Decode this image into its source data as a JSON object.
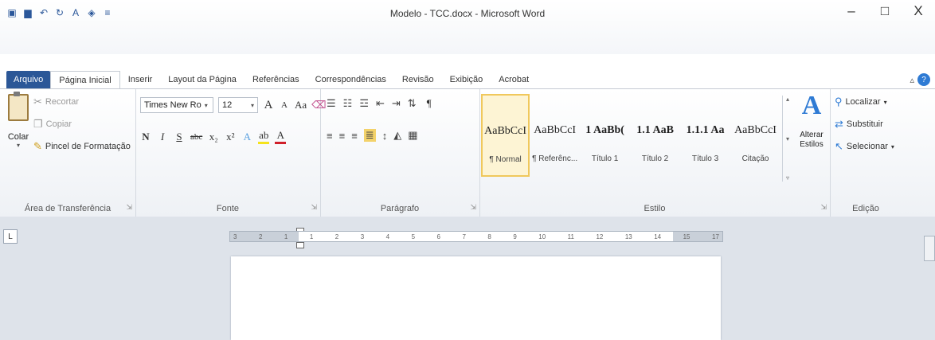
{
  "window": {
    "title": "Modelo - TCC.docx - Microsoft Word",
    "minimize": "–",
    "maximize": "□",
    "close": "X"
  },
  "qat": [
    {
      "icon": "word-icon"
    },
    {
      "icon": "save-icon"
    },
    {
      "icon": "undo-icon"
    },
    {
      "icon": "redo-icon"
    },
    {
      "icon": "font-color-icon"
    },
    {
      "icon": "highlight-icon"
    },
    {
      "icon": "customize-icon"
    }
  ],
  "tabs": {
    "file": "Arquivo",
    "home": "Página Inicial",
    "insert": "Inserir",
    "layout": "Layout da Página",
    "references": "Referências",
    "mailings": "Correspondências",
    "review": "Revisão",
    "view": "Exibição",
    "acrobat": "Acrobat"
  },
  "ribbon": {
    "clipboard": {
      "label": "Área de Transferência",
      "paste": "Colar",
      "cut": "Recortar",
      "copy": "Copiar",
      "format_painter": "Pincel de Formatação"
    },
    "font": {
      "label": "Fonte",
      "font_name": "Times New Ro",
      "font_size": "12",
      "bold": "N",
      "italic": "I",
      "underline": "S",
      "strike": "abc",
      "subscript": "x₂",
      "superscript": "x²",
      "grow": "A",
      "shrink": "A",
      "case": "Aa"
    },
    "paragraph": {
      "label": "Parágrafo",
      "pilcrow": "¶"
    },
    "styles": {
      "label": "Estilo",
      "items": [
        {
          "sample": "AaBbCcI",
          "name": "¶ Normal",
          "selected": true
        },
        {
          "sample": "AaBbCcI",
          "name": "¶ Referênc...",
          "selected": false
        },
        {
          "sample": "1 AaBb(",
          "name": "Título 1",
          "selected": false
        },
        {
          "sample": "1.1 AaB",
          "name": "Título 2",
          "selected": false
        },
        {
          "sample": "1.1.1 Aa",
          "name": "Título 3",
          "selected": false
        },
        {
          "sample": "AaBbCcI",
          "name": "Citação",
          "selected": false
        }
      ],
      "change_styles": "Alterar Estilos"
    },
    "editing": {
      "label": "Edição",
      "find": "Localizar",
      "replace": "Substituir",
      "select": "Selecionar"
    }
  },
  "ruler": {
    "ticks": [
      "3",
      "2",
      "1",
      "1",
      "2",
      "3",
      "4",
      "5",
      "6",
      "7",
      "8",
      "9",
      "10",
      "11",
      "12",
      "13",
      "14",
      "15",
      "17"
    ]
  },
  "tab_selector": "L"
}
